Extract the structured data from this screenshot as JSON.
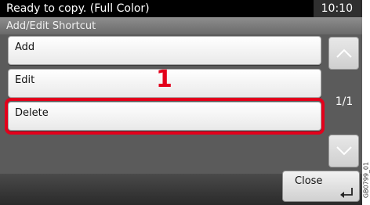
{
  "status": {
    "message": "Ready to copy. (Full Color)",
    "time": "10:10"
  },
  "screen_title": "Add/Edit Shortcut",
  "list": {
    "items": [
      "Add",
      "Edit",
      "Delete"
    ]
  },
  "scroll": {
    "page_indicator": "1/1",
    "up_icon": "chevron-up-icon",
    "down_icon": "chevron-down-icon"
  },
  "callout": {
    "step_number": "1",
    "color": "#e3001b"
  },
  "footer": {
    "close_label": "Close",
    "close_icon": "enter-icon"
  },
  "doc_code": "GB0799_01"
}
